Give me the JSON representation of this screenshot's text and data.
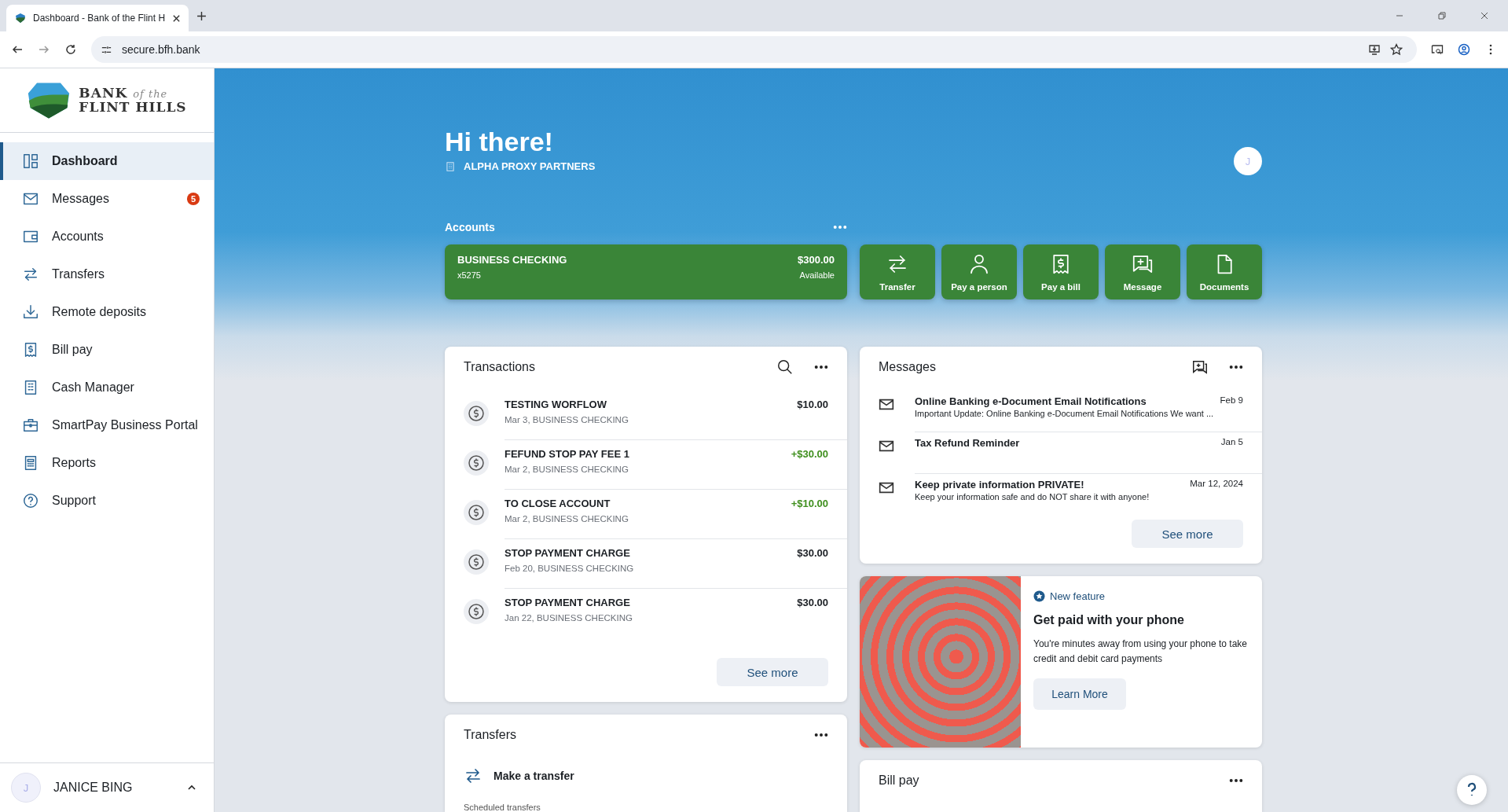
{
  "browser": {
    "tab_title": "Dashboard - Bank of the Flint H",
    "url": "secure.bfh.bank"
  },
  "sidebar": {
    "logo": {
      "line1": "BANK",
      "small": "of the",
      "line2": "FLINT HILLS"
    },
    "items": [
      {
        "label": "Dashboard",
        "selected": true
      },
      {
        "label": "Messages",
        "selected": false,
        "badge": "5"
      },
      {
        "label": "Accounts",
        "selected": false
      },
      {
        "label": "Transfers",
        "selected": false
      },
      {
        "label": "Remote deposits",
        "selected": false
      },
      {
        "label": "Bill pay",
        "selected": false
      },
      {
        "label": "Cash Manager",
        "selected": false
      },
      {
        "label": "SmartPay Business Portal",
        "selected": false
      },
      {
        "label": "Reports",
        "selected": false
      },
      {
        "label": "Support",
        "selected": false
      }
    ],
    "user": {
      "initial": "J",
      "name": "JANICE BING"
    }
  },
  "header": {
    "greeting": "Hi there!",
    "company": "ALPHA PROXY PARTNERS",
    "avatar_initial": "J"
  },
  "accounts": {
    "title": "Accounts",
    "cards": [
      {
        "name": "BUSINESS CHECKING",
        "number": "x5275",
        "balance": "$300.00",
        "balance_label": "Available"
      }
    ],
    "actions": [
      "Transfer",
      "Pay a person",
      "Pay a bill",
      "Message",
      "Documents"
    ]
  },
  "transactions": {
    "title": "Transactions",
    "see_more": "See more",
    "rows": [
      {
        "title": "TESTING WORFLOW",
        "subtitle": "Mar 3, BUSINESS CHECKING",
        "amount": "$10.00",
        "credit": false
      },
      {
        "title": "FEFUND STOP PAY FEE 1",
        "subtitle": "Mar 2, BUSINESS CHECKING",
        "amount": "+$30.00",
        "credit": true
      },
      {
        "title": "TO CLOSE ACCOUNT",
        "subtitle": "Mar 2, BUSINESS CHECKING",
        "amount": "+$10.00",
        "credit": true
      },
      {
        "title": "STOP PAYMENT CHARGE",
        "subtitle": "Feb 20, BUSINESS CHECKING",
        "amount": "$30.00",
        "credit": false
      },
      {
        "title": "STOP PAYMENT CHARGE",
        "subtitle": "Jan 22, BUSINESS CHECKING",
        "amount": "$30.00",
        "credit": false
      }
    ]
  },
  "transfers": {
    "title": "Transfers",
    "action": "Make a transfer",
    "section_label": "Scheduled transfers"
  },
  "messages": {
    "title": "Messages",
    "see_more": "See more",
    "rows": [
      {
        "subject": "Online Banking e-Document Email Notifications",
        "preview": "Important Update: Online Banking e-Document Email Notifications We want ...",
        "date": "Feb 9"
      },
      {
        "subject": "Tax Refund Reminder",
        "date": "Jan 5"
      },
      {
        "subject": "Keep private information PRIVATE!",
        "preview": "Keep your information safe and do NOT share it with anyone!",
        "date": "Mar 12, 2024"
      }
    ]
  },
  "feature": {
    "tag": "New feature",
    "title": "Get paid with your phone",
    "body": "You're minutes away from using your phone to take credit and debit card payments",
    "button": "Learn More"
  },
  "bill_pay": {
    "title": "Bill pay"
  }
}
